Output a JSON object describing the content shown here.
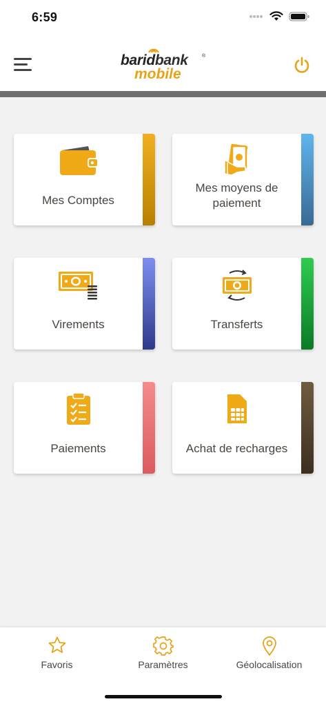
{
  "status_bar": {
    "time": "6:59"
  },
  "header": {
    "logo": {
      "part1": "barid",
      "part2": "bank",
      "part3": "mobile",
      "reg": "®"
    }
  },
  "tiles": [
    {
      "label": "Mes Comptes",
      "icon": "wallet-icon",
      "accent": [
        "#f0b020",
        "#b88000"
      ]
    },
    {
      "label": "Mes moyens de paiement",
      "icon": "payment-methods-icon",
      "accent": [
        "#5fb5ee",
        "#3a6a92"
      ]
    },
    {
      "label": "Virements",
      "icon": "money-transfer-icon",
      "accent": [
        "#7d8ef0",
        "#2e3a8a"
      ]
    },
    {
      "label": "Transferts",
      "icon": "cash-exchange-icon",
      "accent": [
        "#2ecc50",
        "#0c7a25"
      ]
    },
    {
      "label": "Paiements",
      "icon": "clipboard-checklist-icon",
      "accent": [
        "#f58b8b",
        "#dc5a60"
      ]
    },
    {
      "label": "Achat de recharges",
      "icon": "sim-card-icon",
      "accent": [
        "#6e5b40",
        "#3d2e20"
      ]
    }
  ],
  "tab_bar": {
    "items": [
      {
        "label": "Favoris",
        "icon": "star-icon"
      },
      {
        "label": "Paramètres",
        "icon": "gear-icon"
      },
      {
        "label": "Géolocalisation",
        "icon": "location-pin-icon"
      }
    ]
  },
  "colors": {
    "brand": "#e7a317",
    "text": "#4a4540",
    "divider": "#6f6f6f"
  }
}
